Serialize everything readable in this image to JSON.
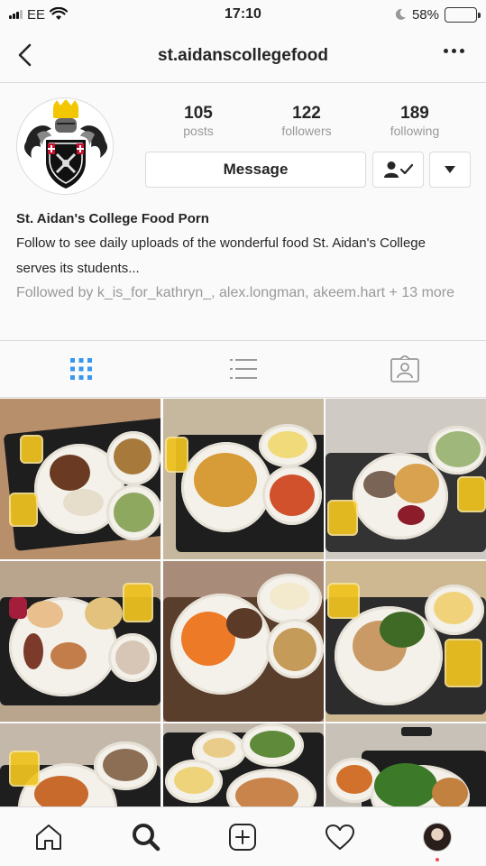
{
  "status_bar": {
    "carrier": "EE",
    "time": "17:10",
    "battery_percent": "58%",
    "battery_level": 0.58,
    "battery_color": "#f6c90e"
  },
  "nav": {
    "title": "st.aidanscollegefood",
    "back_icon": "chevron-left-icon",
    "more_icon": "more-horizontal-icon"
  },
  "profile": {
    "stats": [
      {
        "value": "105",
        "label": "posts"
      },
      {
        "value": "122",
        "label": "followers"
      },
      {
        "value": "189",
        "label": "following"
      }
    ],
    "message_label": "Message",
    "name": "St. Aidan's College Food Porn",
    "bio": "Follow to see daily uploads of the wonderful food St. Aidan's College serves its students...",
    "followed_by": "Followed by k_is_for_kathryn_, alex.longman, akeem.hart + 13 more"
  },
  "tabs": [
    {
      "icon": "grid-icon",
      "active": true,
      "color": "#3897f0"
    },
    {
      "icon": "list-icon",
      "active": false
    },
    {
      "icon": "tagged-icon",
      "active": false
    }
  ],
  "bottom_nav": [
    {
      "icon": "home-icon"
    },
    {
      "icon": "search-icon",
      "active": true
    },
    {
      "icon": "add-post-icon"
    },
    {
      "icon": "heart-icon"
    },
    {
      "icon": "profile-avatar-icon"
    }
  ],
  "grid_posts": 9
}
